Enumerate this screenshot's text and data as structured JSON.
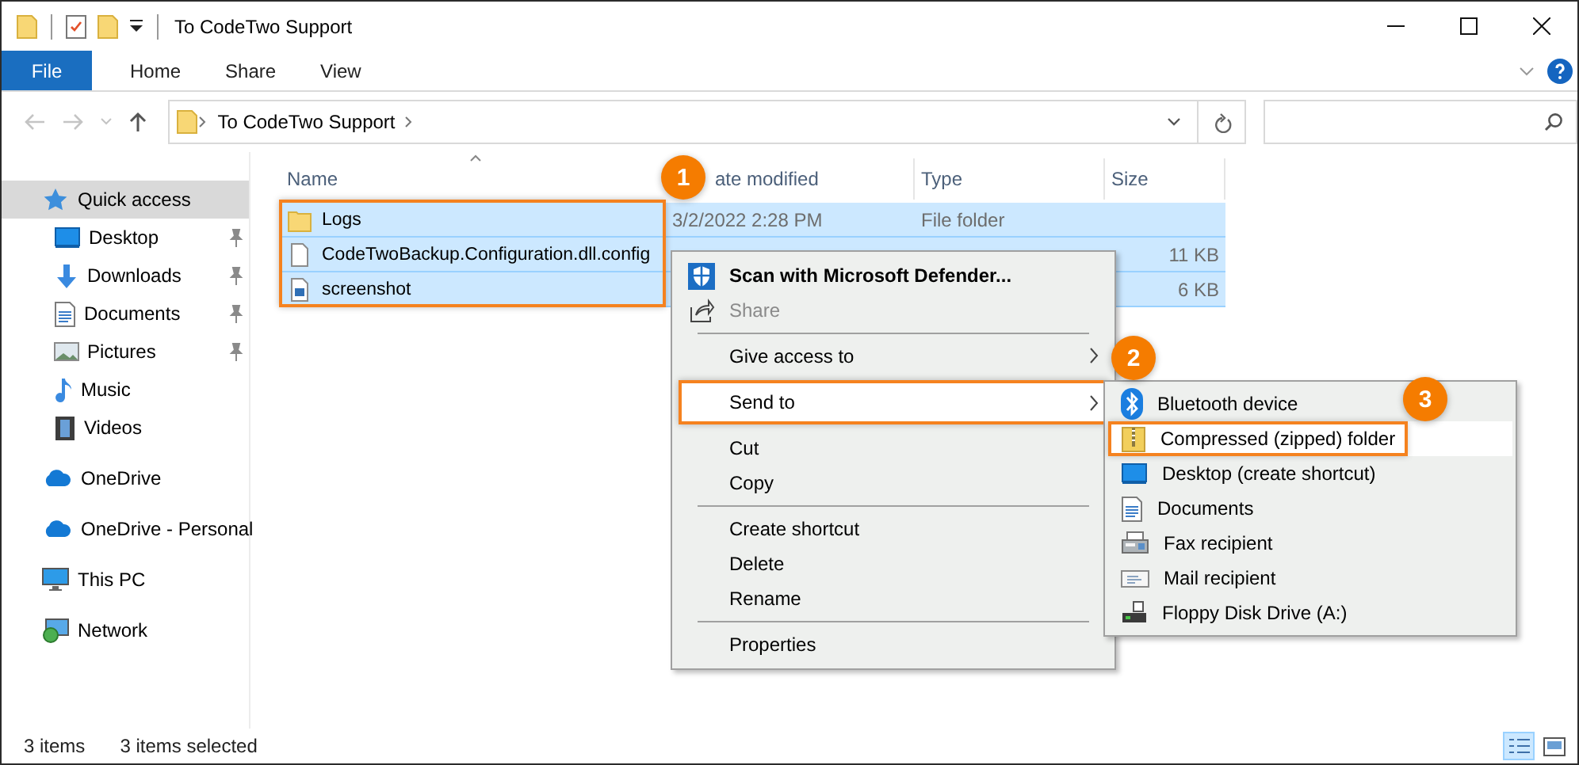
{
  "window": {
    "title": "To CodeTwo Support"
  },
  "ribbon": {
    "tabs": [
      {
        "label": "File",
        "kind": "file"
      },
      {
        "label": "Home",
        "kind": "tab"
      },
      {
        "label": "Share",
        "kind": "tab"
      },
      {
        "label": "View",
        "kind": "tab"
      }
    ]
  },
  "address": {
    "path": [
      "To CodeTwo Support"
    ]
  },
  "sidebar": {
    "items": [
      {
        "label": "Quick access",
        "kind": "star",
        "selected": true,
        "children": [
          {
            "label": "Desktop",
            "kind": "desktop",
            "pinned": true,
            "selected": false
          },
          {
            "label": "Downloads",
            "kind": "downloads",
            "pinned": true,
            "selected": false
          },
          {
            "label": "Documents",
            "kind": "documents",
            "pinned": true,
            "selected": false
          },
          {
            "label": "Pictures",
            "kind": "pictures",
            "pinned": true,
            "selected": false
          },
          {
            "label": "Music",
            "kind": "music",
            "pinned": false,
            "selected": false
          },
          {
            "label": "Videos",
            "kind": "videos",
            "pinned": false,
            "selected": false
          }
        ]
      },
      {
        "label": "OneDrive",
        "kind": "cloud",
        "selected": false
      },
      {
        "label": "OneDrive - Personal",
        "kind": "cloud",
        "selected": false
      },
      {
        "label": "This PC",
        "kind": "pc",
        "selected": false
      },
      {
        "label": "Network",
        "kind": "network",
        "selected": false
      }
    ]
  },
  "file_list": {
    "columns": [
      {
        "label": "Name",
        "sorted": true
      },
      {
        "label": "ate modified",
        "sorted": false
      },
      {
        "label": "Type",
        "sorted": false
      },
      {
        "label": "Size",
        "sorted": false
      }
    ],
    "callout": "1",
    "rows": [
      {
        "name": "Logs",
        "kind": "folder",
        "date": "3/2/2022 2:28 PM",
        "type": "File folder",
        "selected": true
      },
      {
        "name": "CodeTwoBackup.Configuration.dll.config",
        "kind": "file",
        "size": "11 KB",
        "selected": true
      },
      {
        "name": "screenshot",
        "kind": "image",
        "size": "6 KB",
        "selected": true
      }
    ]
  },
  "context_menu": {
    "items": [
      {
        "kind": "defender",
        "label": "Scan with Microsoft Defender...",
        "bold": true,
        "disabled": false,
        "submenu": false,
        "selected": false
      },
      {
        "kind": "share",
        "label": "Share",
        "bold": false,
        "disabled": true,
        "submenu": false,
        "selected": false
      },
      {
        "kind": "separator"
      },
      {
        "kind": "plain",
        "label": "Give access to",
        "bold": false,
        "disabled": false,
        "submenu": true,
        "selected": false
      },
      {
        "kind": "plain",
        "label": "Send to",
        "bold": false,
        "disabled": false,
        "submenu": true,
        "selected": true,
        "callout": "2"
      },
      {
        "kind": "plain",
        "label": "Cut",
        "bold": false,
        "disabled": false,
        "submenu": false,
        "selected": false
      },
      {
        "kind": "plain",
        "label": "Copy",
        "bold": false,
        "disabled": false,
        "submenu": false,
        "selected": false
      },
      {
        "kind": "separator"
      },
      {
        "kind": "plain",
        "label": "Create shortcut",
        "bold": false,
        "disabled": false,
        "submenu": false,
        "selected": false
      },
      {
        "kind": "plain",
        "label": "Delete",
        "bold": false,
        "disabled": false,
        "submenu": false,
        "selected": false
      },
      {
        "kind": "plain",
        "label": "Rename",
        "bold": false,
        "disabled": false,
        "submenu": false,
        "selected": false
      },
      {
        "kind": "separator"
      },
      {
        "kind": "plain",
        "label": "Properties",
        "bold": false,
        "disabled": false,
        "submenu": false,
        "selected": false
      }
    ]
  },
  "submenu": {
    "items": [
      {
        "kind": "bluetooth",
        "label": "Bluetooth device",
        "selected": false
      },
      {
        "kind": "zip",
        "label": "Compressed (zipped) folder",
        "selected": true,
        "callout": "3"
      },
      {
        "kind": "desktop",
        "label": "Desktop (create shortcut)",
        "selected": false
      },
      {
        "kind": "documents",
        "label": "Documents",
        "selected": false
      },
      {
        "kind": "fax",
        "label": "Fax recipient",
        "selected": false
      },
      {
        "kind": "mail",
        "label": "Mail recipient",
        "selected": false
      },
      {
        "kind": "floppy",
        "label": "Floppy Disk Drive (A:)",
        "selected": false
      }
    ]
  },
  "status_bar": {
    "item_count": "3 items",
    "selection": "3 items selected",
    "views": [
      {
        "kind": "details",
        "selected": true
      },
      {
        "kind": "large-icons",
        "selected": false
      }
    ]
  }
}
